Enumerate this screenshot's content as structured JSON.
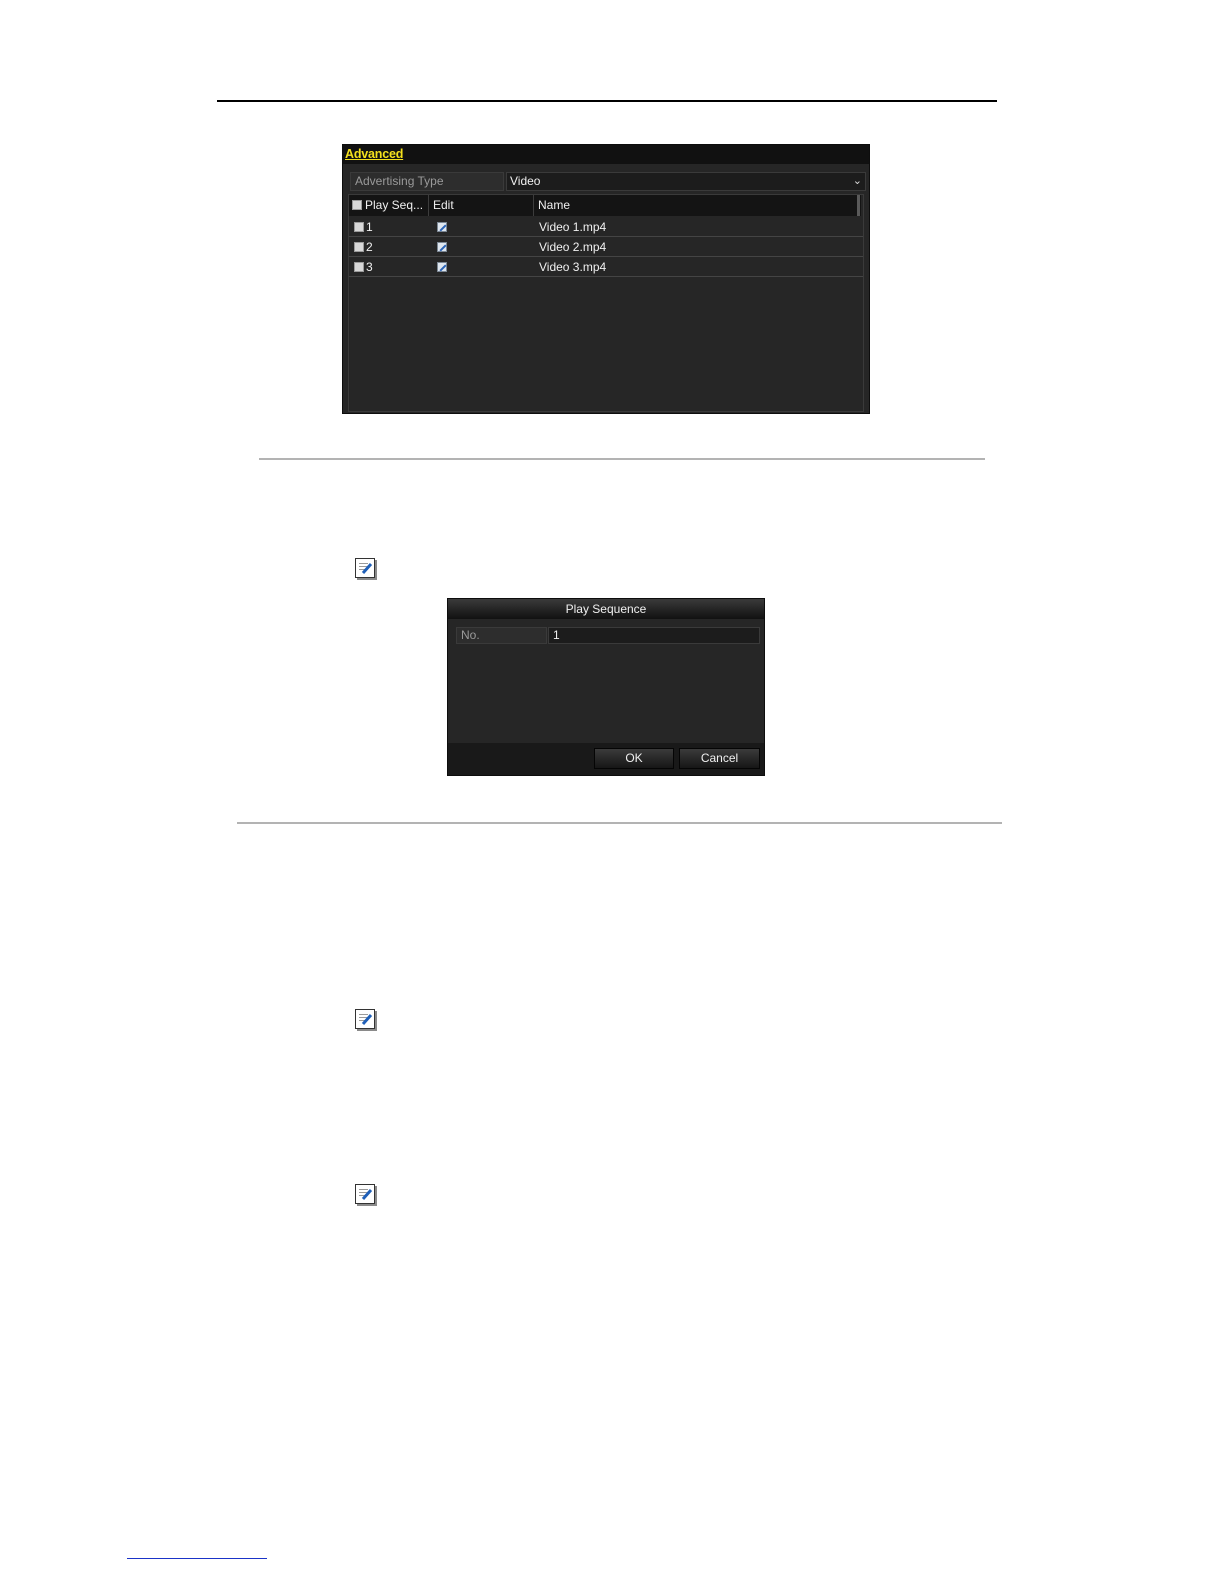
{
  "advanced_panel": {
    "tab_label": "Advanced",
    "advertising_type_label": "Advertising Type",
    "advertising_type_value": "Video",
    "columns": [
      "Play Seq...",
      "Edit",
      "Name"
    ],
    "rows": [
      {
        "seq": "1",
        "name": "Video 1.mp4"
      },
      {
        "seq": "2",
        "name": "Video 2.mp4"
      },
      {
        "seq": "3",
        "name": "Video 3.mp4"
      }
    ]
  },
  "icons": {
    "note": "note-pencil-icon",
    "edit": "edit-pencil-icon",
    "checkbox": "checkbox-icon",
    "chevron": "chevron-down-icon"
  },
  "play_sequence_dialog": {
    "title": "Play Sequence",
    "field_label": "No.",
    "field_value": "1",
    "ok_label": "OK",
    "cancel_label": "Cancel"
  },
  "colors": {
    "tab_accent": "#f4e01d",
    "panel_background": "#262626",
    "link_underline": "#1a33c8"
  }
}
